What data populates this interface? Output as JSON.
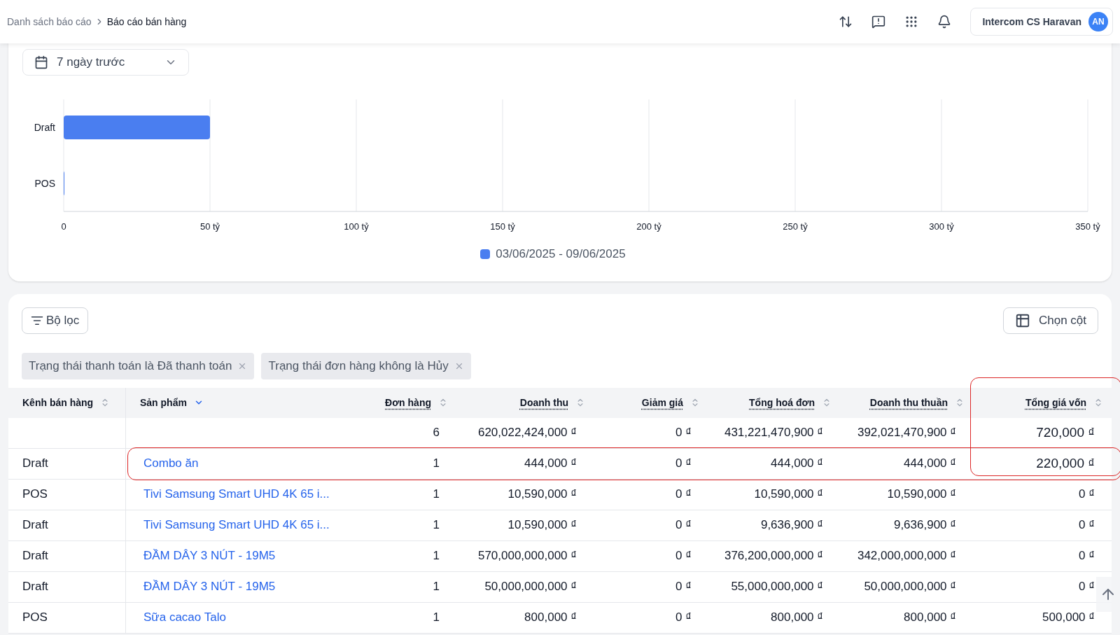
{
  "breadcrumb": [
    {
      "label": "Danh sách báo cáo",
      "current": false
    },
    {
      "label": "Báo cáo bán hàng",
      "current": true
    }
  ],
  "user": {
    "name": "Intercom CS Haravan",
    "initials": "AN"
  },
  "date_range": {
    "value": "7 ngày trước"
  },
  "chart": {
    "chart_data": {
      "type": "bar",
      "orientation": "horizontal",
      "categories": [
        "Draft",
        "POS"
      ],
      "grid": true,
      "series": [
        {
          "name": "03/06/2025 - 09/06/2025",
          "color": "#4a7ef0",
          "values": [
            50,
            0.2
          ]
        }
      ],
      "xlim": [
        0,
        350
      ],
      "xticks": [
        {
          "value": 0,
          "label": "0"
        },
        {
          "value": 50,
          "label": "50 tỷ"
        },
        {
          "value": 100,
          "label": "100 tỷ"
        },
        {
          "value": 150,
          "label": "150 tỷ"
        },
        {
          "value": 200,
          "label": "200 tỷ"
        },
        {
          "value": 250,
          "label": "250 tỷ"
        },
        {
          "value": 300,
          "label": "300 tỷ"
        },
        {
          "value": 350,
          "label": "350 tỷ"
        }
      ]
    }
  },
  "toolbar": {
    "filter_button": "Bộ lọc",
    "columns_button": "Chọn cột"
  },
  "filters": [
    {
      "label": "Trạng thái thanh toán là Đã thanh toán"
    },
    {
      "label": "Trạng thái đơn hàng không là Hủy"
    }
  ],
  "table": {
    "columns": [
      {
        "label": "Kênh bán hàng",
        "kind": "sortable",
        "underlined": false,
        "highlighted": false
      },
      {
        "label": "Sản phẩm",
        "kind": "dropdown",
        "underlined": false,
        "highlighted": false
      },
      {
        "label": "Đơn hàng",
        "kind": "sortable",
        "underlined": true,
        "highlighted": false
      },
      {
        "label": "Doanh thu",
        "kind": "sortable",
        "underlined": true,
        "highlighted": false
      },
      {
        "label": "Giảm giá",
        "kind": "sortable",
        "underlined": true,
        "highlighted": false
      },
      {
        "label": "Tổng hoá đơn",
        "kind": "sortable",
        "underlined": true,
        "highlighted": false
      },
      {
        "label": "Doanh thu thuần",
        "kind": "sortable",
        "underlined": true,
        "highlighted": false
      },
      {
        "label": "Tổng giá vốn",
        "kind": "sortable",
        "underlined": true,
        "highlighted": true
      }
    ],
    "total_row": [
      "6",
      "620,022,424,000 ₫",
      "0 ₫",
      "431,221,470,900 ₫",
      "392,021,470,900 ₫",
      "720,000 ₫"
    ],
    "rows": [
      {
        "channel": "Draft",
        "product": "Combo ăn",
        "values": [
          "1",
          "444,000 ₫",
          "0 ₫",
          "444,000 ₫",
          "444,000 ₫",
          "220,000 ₫"
        ],
        "highlighted": true
      },
      {
        "channel": "POS",
        "product": "Tivi Samsung Smart UHD 4K 65 i...",
        "values": [
          "1",
          "10,590,000 ₫",
          "0 ₫",
          "10,590,000 ₫",
          "10,590,000 ₫",
          "0 ₫"
        ],
        "highlighted": false
      },
      {
        "channel": "Draft",
        "product": "Tivi Samsung Smart UHD 4K 65 i...",
        "values": [
          "1",
          "10,590,000 ₫",
          "0 ₫",
          "9,636,900 ₫",
          "9,636,900 ₫",
          "0 ₫"
        ],
        "highlighted": false
      },
      {
        "channel": "Draft",
        "product": "ĐẦM DÂY 3 NÚT - 19M5",
        "values": [
          "1",
          "570,000,000,000 ₫",
          "0 ₫",
          "376,200,000,000 ₫",
          "342,000,000,000 ₫",
          "0 ₫"
        ],
        "highlighted": false
      },
      {
        "channel": "Draft",
        "product": "ĐẦM DÂY 3 NÚT - 19M5",
        "values": [
          "1",
          "50,000,000,000 ₫",
          "0 ₫",
          "55,000,000,000 ₫",
          "50,000,000,000 ₫",
          "0 ₫"
        ],
        "highlighted": false
      },
      {
        "channel": "POS",
        "product": "Sữa cacao Talo",
        "values": [
          "1",
          "800,000 ₫",
          "0 ₫",
          "800,000 ₫",
          "800,000 ₫",
          "500,000 ₫"
        ],
        "highlighted": false
      }
    ]
  }
}
